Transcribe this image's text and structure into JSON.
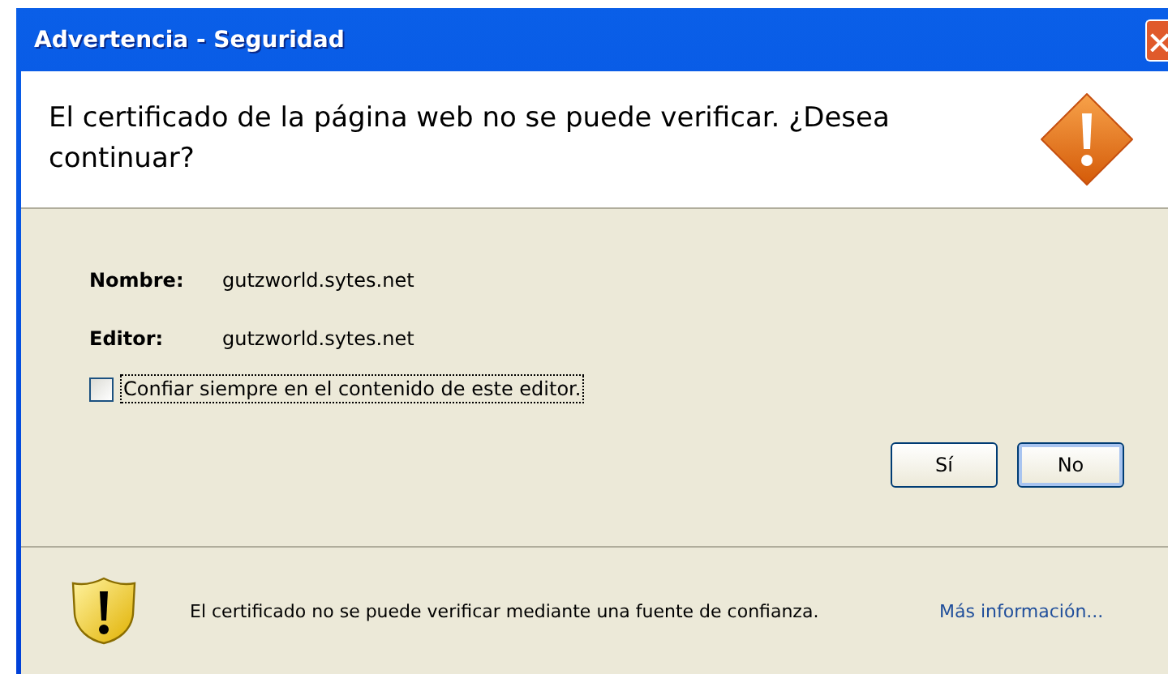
{
  "window": {
    "title": "Advertencia - Seguridad"
  },
  "header": {
    "message": "El certificado de la página web no se puede verificar. ¿Desea continuar?"
  },
  "details": [
    {
      "label": "Nombre:",
      "value": "gutzworld.sytes.net"
    },
    {
      "label": "Editor:",
      "value": "gutzworld.sytes.net"
    }
  ],
  "trust_checkbox": {
    "label": "Confiar siempre en el contenido de este editor.",
    "checked": false
  },
  "buttons": [
    {
      "label": "Sí",
      "selected": false
    },
    {
      "label": "No",
      "selected": true
    }
  ],
  "footer": {
    "message": "El certificado no se puede verificar mediante una fuente de confianza.",
    "link": "Más información..."
  }
}
